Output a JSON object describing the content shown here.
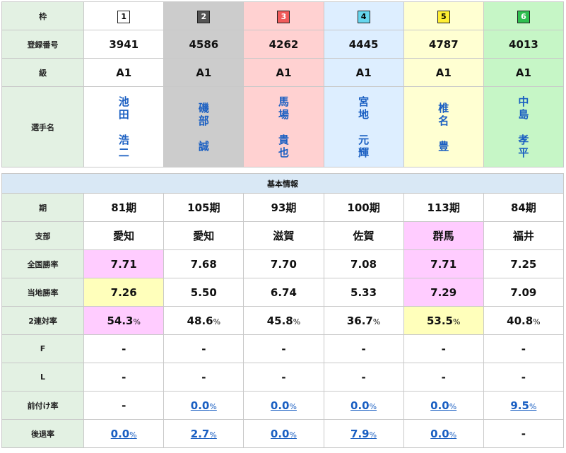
{
  "header": {
    "labels": {
      "waku": "枠",
      "reg": "登録番号",
      "class": "級",
      "name": "選手名"
    },
    "racers": [
      {
        "waku": "1",
        "reg": "3941",
        "class": "A1",
        "name_top": [
          "池",
          "田"
        ],
        "name_bottom": [
          "浩",
          "二"
        ]
      },
      {
        "waku": "2",
        "reg": "4586",
        "class": "A1",
        "name_top": [
          "磯",
          "部"
        ],
        "name_bottom": [
          "誠"
        ]
      },
      {
        "waku": "3",
        "reg": "4262",
        "class": "A1",
        "name_top": [
          "馬",
          "場"
        ],
        "name_bottom": [
          "貴",
          "也"
        ]
      },
      {
        "waku": "4",
        "reg": "4445",
        "class": "A1",
        "name_top": [
          "宮",
          "地"
        ],
        "name_bottom": [
          "元",
          "輝"
        ]
      },
      {
        "waku": "5",
        "reg": "4787",
        "class": "A1",
        "name_top": [
          "椎",
          "名"
        ],
        "name_bottom": [
          "豊"
        ]
      },
      {
        "waku": "6",
        "reg": "4013",
        "class": "A1",
        "name_top": [
          "中",
          "島"
        ],
        "name_bottom": [
          "孝",
          "平"
        ]
      }
    ],
    "waku_colors": [
      "#ffffff",
      "#555555",
      "#f05a5a",
      "#66d6ee",
      "#ffee33",
      "#2ebf4f"
    ],
    "column_colors": [
      "#ffffff",
      "#cccccc",
      "#ffd1d1",
      "#ddeeff",
      "#ffffd2",
      "#c6f6c6"
    ]
  },
  "basic": {
    "section_title": "基本情報",
    "rows": [
      {
        "label": "期",
        "values": [
          "81期",
          "105期",
          "93期",
          "100期",
          "113期",
          "84期"
        ]
      },
      {
        "label": "支部",
        "values": [
          "愛知",
          "愛知",
          "滋賀",
          "佐賀",
          "群馬",
          "福井"
        ]
      },
      {
        "label": "全国勝率",
        "values": [
          "7.71",
          "7.68",
          "7.70",
          "7.08",
          "7.71",
          "7.25"
        ]
      },
      {
        "label": "当地勝率",
        "values": [
          "7.26",
          "5.50",
          "6.74",
          "5.33",
          "7.29",
          "7.09"
        ]
      },
      {
        "label": "2連対率",
        "values": [
          "54.3",
          "48.6",
          "45.8",
          "36.7",
          "53.5",
          "40.8"
        ],
        "unit": "%"
      },
      {
        "label": "F",
        "values": [
          "-",
          "-",
          "-",
          "-",
          "-",
          "-"
        ]
      },
      {
        "label": "L",
        "values": [
          "-",
          "-",
          "-",
          "-",
          "-",
          "-"
        ]
      },
      {
        "label": "前付け率",
        "values": [
          "-",
          "0.0",
          "0.0",
          "0.0",
          "0.0",
          "9.5"
        ],
        "unit": "%"
      },
      {
        "label": "後退率",
        "values": [
          "0.0",
          "2.7",
          "0.0",
          "7.9",
          "0.0",
          "-"
        ],
        "unit": "%"
      }
    ]
  },
  "highlight_colors": {
    "pink": "#ffccff",
    "yellow": "#ffffbb"
  }
}
